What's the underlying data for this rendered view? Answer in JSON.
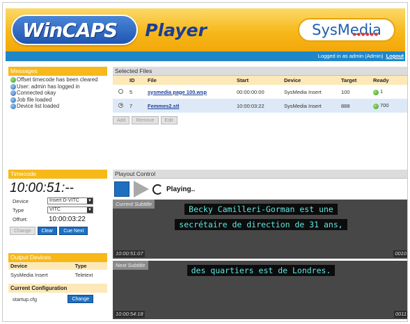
{
  "header": {
    "logo_wincaps": "WinCAPS",
    "logo_player": "Player",
    "brand": "SysMedia",
    "login_text": "Logged in as admin (Admin)",
    "logout_label": "Logout"
  },
  "messages": {
    "title": "Messages",
    "items": [
      {
        "icon": "ok",
        "text": "Offset timecode has been cleared"
      },
      {
        "icon": "info",
        "text": "User: admin has logged in"
      },
      {
        "icon": "info",
        "text": "Connected okay"
      },
      {
        "icon": "info",
        "text": "Job file loaded"
      },
      {
        "icon": "info",
        "text": "Device list loaded"
      }
    ]
  },
  "timecode": {
    "title": "Timecode",
    "current": "10:00:51:--",
    "device_label": "Device",
    "device_value": "Insert D-VITC",
    "type_label": "Type",
    "type_value": "VITC",
    "offset_label": "Offset:",
    "offset_value": "10:00:03:22",
    "change_label": "Change",
    "clear_label": "Clear",
    "cue_next_label": "Cue Next"
  },
  "output_devices": {
    "title": "Output Devices",
    "col_device": "Device",
    "col_type": "Type",
    "rows": [
      {
        "device": "SysMedia Insert",
        "type": "Teletext"
      }
    ],
    "config_title": "Current Configuration",
    "config_file": "startup.cfg",
    "config_change_label": "Change"
  },
  "files": {
    "title": "Selected Files",
    "columns": {
      "id": "ID",
      "file": "File",
      "start": "Start",
      "device": "Device",
      "target": "Target",
      "ready": "Ready"
    },
    "rows": [
      {
        "id": "5",
        "file": "sysmedia page 100.wsp",
        "start": "00:00:00:00",
        "device": "SysMedia Insert",
        "target": "100",
        "ready": "1",
        "selected": false
      },
      {
        "id": "7",
        "file": "Femmes2.stl",
        "start": "10:00:03:22",
        "device": "SysMedia Insert",
        "target": "888",
        "ready": "700",
        "selected": true
      }
    ],
    "add_label": "Add",
    "remove_label": "Remove",
    "edit_label": "Edit"
  },
  "playout": {
    "title": "Playout Control",
    "status": "Playing..",
    "current_tag": "Current Subtitle",
    "current_line1": "Becky Camilleri-Gorman est une",
    "current_line2": "secrétaire de direction de 31 ans,",
    "current_tc": "10:00:51:07",
    "current_count": "0010",
    "next_tag": "Next Subtitle",
    "next_line1": "des quartiers est de Londres.",
    "next_tc": "10:00:54:18",
    "next_count": "0011"
  },
  "colors": {
    "header_yellow": "#f7b81a",
    "login_blue": "#1f87c8",
    "button_blue": "#1f6fc0",
    "subtitle_cyan": "#5fe8e4",
    "subtitle_bg": "#474747"
  }
}
